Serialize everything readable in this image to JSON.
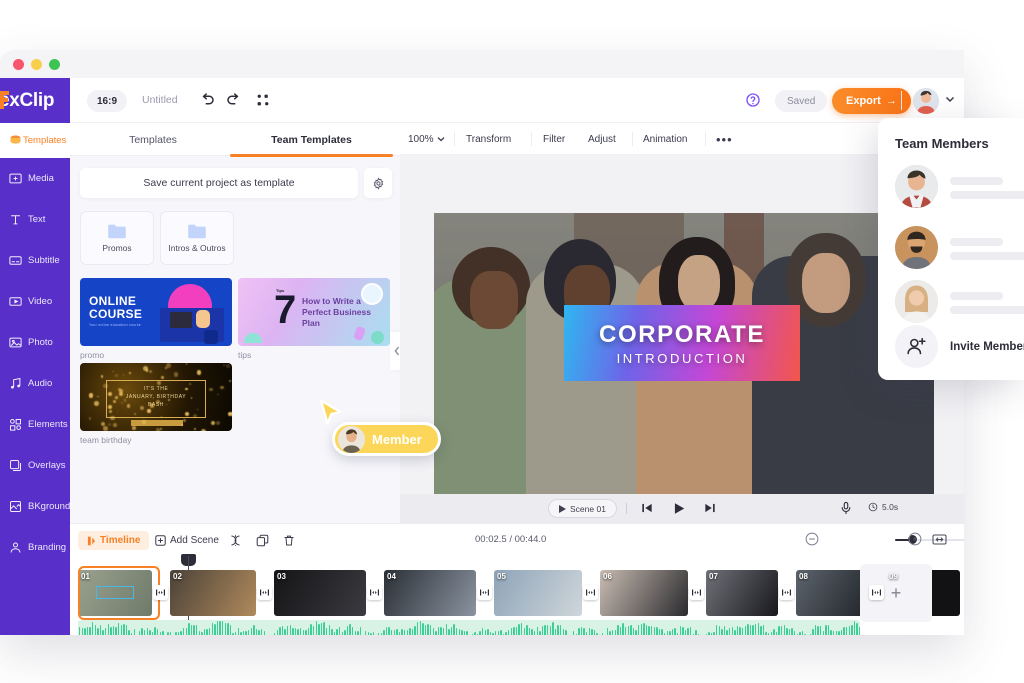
{
  "window": {
    "traffic_lights": [
      "close",
      "minimize",
      "maximize"
    ]
  },
  "brand": {
    "logo_text": "lexClip",
    "primary": "#5830c9",
    "accent": "#f98125"
  },
  "sidebar": {
    "active_item": {
      "label": "Templates",
      "icon": "templates-icon"
    },
    "items": [
      {
        "label": "Media",
        "icon": "media-icon"
      },
      {
        "label": "Text",
        "icon": "text-icon"
      },
      {
        "label": "Subtitle",
        "icon": "subtitle-icon"
      },
      {
        "label": "Video",
        "icon": "video-icon"
      },
      {
        "label": "Photo",
        "icon": "photo-icon"
      },
      {
        "label": "Audio",
        "icon": "audio-icon"
      },
      {
        "label": "Elements",
        "icon": "elements-icon"
      },
      {
        "label": "Overlays",
        "icon": "overlays-icon"
      },
      {
        "label": "BKground",
        "icon": "bkground-icon"
      },
      {
        "label": "Branding",
        "icon": "branding-icon"
      }
    ]
  },
  "header": {
    "aspect_ratio": "16:9",
    "project_title": "Untitled",
    "undo_icon": "undo-icon",
    "redo_icon": "redo-icon",
    "grid_icon": "grid-icon",
    "help_icon": "help-icon",
    "save_status": "Saved",
    "export_label": "Export",
    "export_arrow": "→",
    "avatar": "user-avatar"
  },
  "panel": {
    "tabs": [
      {
        "label": "Templates",
        "active": false
      },
      {
        "label": "Team Templates",
        "active": true
      }
    ],
    "save_template_label": "Save current project as template",
    "settings_icon": "gear-icon",
    "folders": [
      {
        "label": "Promos",
        "icon": "folder-icon"
      },
      {
        "label": "Intros & Outros",
        "icon": "folder-icon"
      }
    ],
    "templates": [
      {
        "name": "promo",
        "thumb_title": "ONLINE\nCOURSE",
        "thumb_sub": "Your online education course"
      },
      {
        "name": "tips",
        "thumb_tip": "Tips",
        "thumb_number": "7",
        "thumb_title": "How to Write a Perfect Business Plan"
      },
      {
        "name": "team birthday",
        "thumb_l1": "IT'S THE",
        "thumb_l2": "JANUARY, BIRTHDAY",
        "thumb_l3": "BASH"
      }
    ],
    "collapse_icon": "chevron-left-icon"
  },
  "stage": {
    "zoom": "100%",
    "tools": [
      "Transform",
      "Filter",
      "Adjust",
      "Animation"
    ],
    "more_icon": "more-horizontal-icon",
    "preview": {
      "title": "CORPORATE",
      "subtitle": "INTRODUCTION"
    },
    "player": {
      "scene_label": "Scene 01",
      "prev_icon": "skip-previous-icon",
      "play_icon": "play-icon",
      "next_icon": "skip-next-icon",
      "mic_icon": "microphone-icon",
      "clock_icon": "clock-icon",
      "duration": "5.0s"
    }
  },
  "timeline": {
    "mode_label": "Timeline",
    "mode_icon": "timeline-icon",
    "add_scene_label": "Add Scene",
    "add_scene_icon": "plus-box-icon",
    "split_icon": "split-icon",
    "duplicate_icon": "duplicate-icon",
    "delete_icon": "trash-icon",
    "time_display": "00:02.5 / 00:44.0",
    "zoom_out_icon": "zoom-out-icon",
    "zoom_in_icon": "zoom-in-icon",
    "fit_icon": "fit-to-width-icon",
    "add_scene_plus": "+",
    "scenes": [
      {
        "number": "01",
        "selected": true
      },
      {
        "number": "02",
        "selected": false
      },
      {
        "number": "03",
        "selected": false
      },
      {
        "number": "04",
        "selected": false
      },
      {
        "number": "05",
        "selected": false
      },
      {
        "number": "06",
        "selected": false
      },
      {
        "number": "07",
        "selected": false
      },
      {
        "number": "08",
        "selected": false
      },
      {
        "number": "09",
        "selected": false
      }
    ]
  },
  "member_cursor": {
    "label": "Member",
    "cursor_icon": "pointer-cursor-icon",
    "color": "#fbd658"
  },
  "team_members": {
    "title": "Team Members",
    "members": [
      {
        "avatar": "member-avatar-1"
      },
      {
        "avatar": "member-avatar-2"
      },
      {
        "avatar": "member-avatar-3"
      }
    ],
    "invite_label": "Invite Members",
    "invite_icon": "add-person-icon"
  }
}
